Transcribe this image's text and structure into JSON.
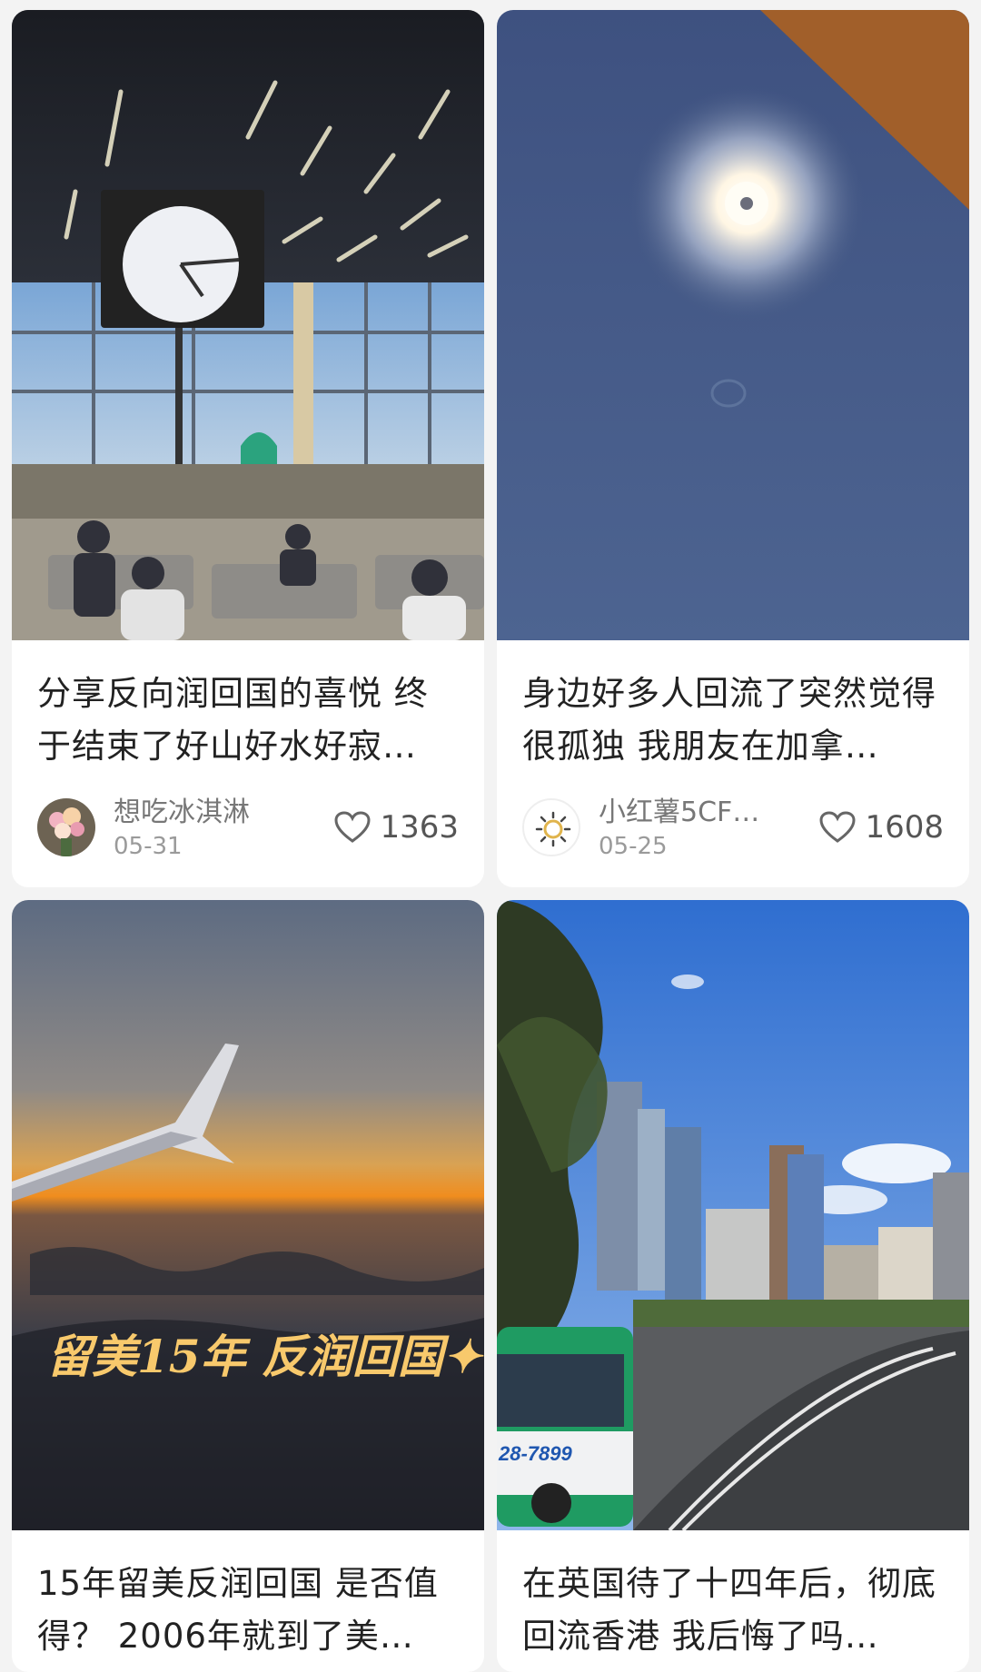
{
  "feed": {
    "cards": [
      {
        "title": "分享反向润回国的喜悦 终于结束了好山好水好寂…",
        "author": "想吃冰淇淋",
        "date": "05-31",
        "likes": "1363",
        "avatar_icon": "flower-bouquet-avatar",
        "cover": "airport-departure-hall-with-clock"
      },
      {
        "title": "身边好多人回流了突然觉得很孤独 我朋友在加拿…",
        "author": "小红薯5CFE…",
        "date": "05-25",
        "likes": "1608",
        "avatar_icon": "sun-avatar",
        "cover": "sun-in-blue-sky"
      },
      {
        "title": "15年留美反润回国 是否值得？ 2006年就到了美…",
        "cover_text": "留美15年 反润回国✦",
        "cover": "sunset-airplane-wing"
      },
      {
        "title": "在英国待了十四年后，彻底回流香港 我后悔了吗…",
        "bus_text": "28-7899",
        "cover": "hong-kong-street-skyline"
      }
    ]
  },
  "colors": {
    "background": "#f3f3f3",
    "card": "#ffffff",
    "title": "#222222",
    "meta": "#9a9a9a"
  }
}
